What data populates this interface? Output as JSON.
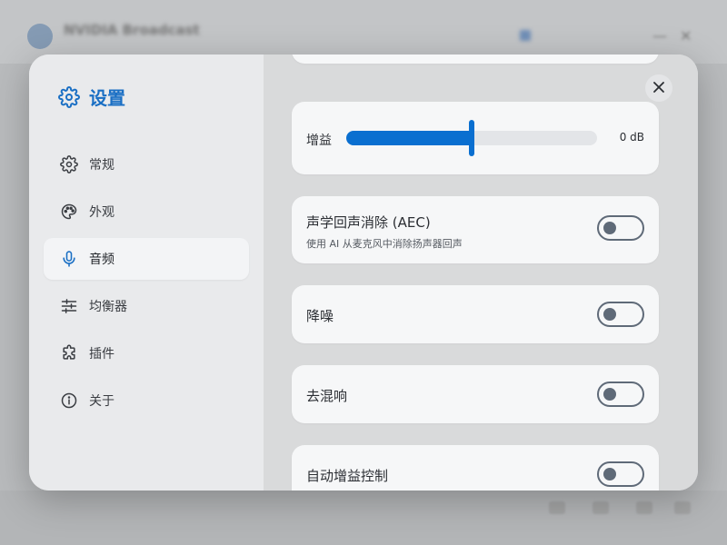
{
  "background_app": {
    "title": "NVIDIA Broadcast",
    "subtitle": "",
    "status_text": "",
    "bottom_left": "",
    "window_controls": [
      "—",
      "▢",
      "✕"
    ]
  },
  "settings": {
    "title": "设置",
    "close_label": "✕",
    "accent_color": "#1a6fc4",
    "nav": [
      {
        "label": "常规",
        "icon": "gear-icon"
      },
      {
        "label": "外观",
        "icon": "palette-icon"
      },
      {
        "label": "音频",
        "icon": "microphone-icon",
        "active": true
      },
      {
        "label": "均衡器",
        "icon": "sliders-icon"
      },
      {
        "label": "插件",
        "icon": "puzzle-icon"
      },
      {
        "label": "关于",
        "icon": "info-icon"
      }
    ],
    "audio": {
      "gain": {
        "label": "增益",
        "value_text": "0 dB",
        "level_percent": 50
      },
      "aec": {
        "title": "声学回声消除 (AEC)",
        "subtitle": "使用 AI 从麦克风中消除扬声器回声",
        "enabled": false
      },
      "noise_suppression": {
        "title": "降噪",
        "enabled": false
      },
      "dereverb": {
        "title": "去混响",
        "enabled": false
      },
      "agc": {
        "title": "自动增益控制",
        "enabled": false
      }
    }
  }
}
